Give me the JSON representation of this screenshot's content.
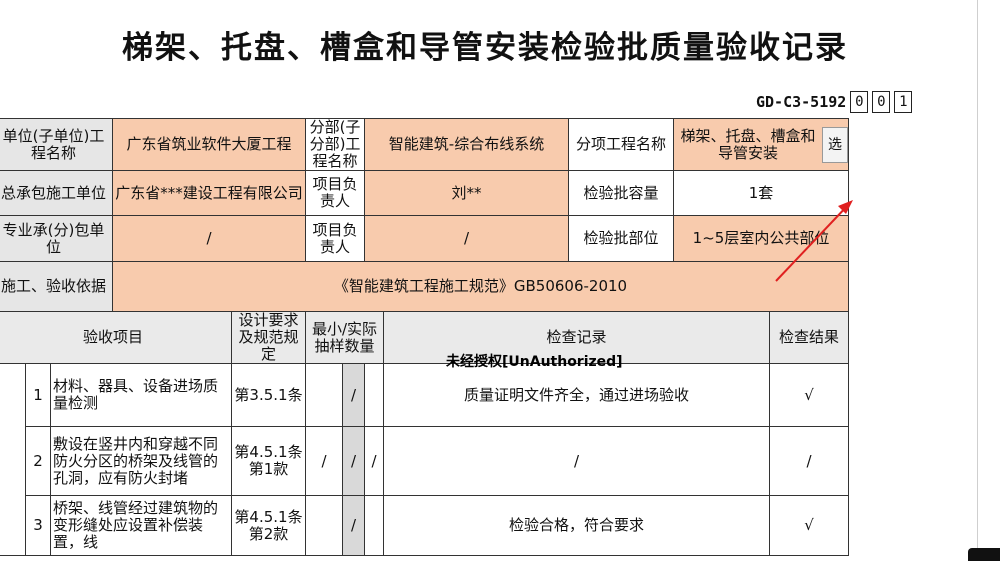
{
  "title": "梯架、托盘、槽盒和导管安装检验批质量验收记录",
  "code": {
    "label": "GD-C3-5192",
    "boxes": [
      "0",
      "0",
      "1"
    ]
  },
  "row1": {
    "unit_label": "单位(子单位)工程名称",
    "unit_value": "广东省筑业软件大厦工程",
    "div_label": "分部(子分部)工程名称",
    "div_value": "智能建筑-综合布线系统",
    "sub_label": "分项工程名称",
    "sub_value": "梯架、托盘、槽盒和导管安装",
    "select": "选"
  },
  "row2": {
    "contractor_label": "总承包施工单位",
    "contractor_value": "广东省***建设工程有限公司",
    "pm_label": "项目负责人",
    "pm_value": "刘**",
    "cap_label": "检验批容量",
    "cap_value": "1套"
  },
  "row3": {
    "sub_label": "专业承(分)包单位",
    "sub_value": "/",
    "pm_label": "项目负责人",
    "pm_value": "/",
    "part_label": "检验批部位",
    "part_value": "1~5层室内公共部位"
  },
  "row4": {
    "basis_label": "施工、验收依据",
    "basis_value": "《智能建筑工程施工规范》GB50606-2010"
  },
  "header": {
    "item": "验收项目",
    "design": "设计要求及规范规定",
    "sample": "最小/实际抽样数量",
    "record": "检查记录",
    "result": "检查结果"
  },
  "watermark": "未经授权[UnAuthorized]",
  "items": [
    {
      "no": "1",
      "name": "材料、器具、设备进场质量检测",
      "rule": "第3.5.1条",
      "s1": "",
      "s2": "/",
      "s3": "",
      "record": "质量证明文件齐全，通过进场验收",
      "result": "√"
    },
    {
      "no": "2",
      "name": "敷设在竖井内和穿越不同防火分区的桥架及线管的孔洞，应有防火封堵",
      "rule": "第4.5.1条第1款",
      "s1": "/",
      "s2": "/",
      "s3": "/",
      "record": "/",
      "result": "/"
    },
    {
      "no": "3",
      "name": "桥架、线管经过建筑物的变形缝处应设置补偿装置，线",
      "rule": "第4.5.1条第2款",
      "s1": "",
      "s2": "/",
      "s3": "",
      "record": "检验合格，符合要求",
      "result": "√"
    }
  ]
}
